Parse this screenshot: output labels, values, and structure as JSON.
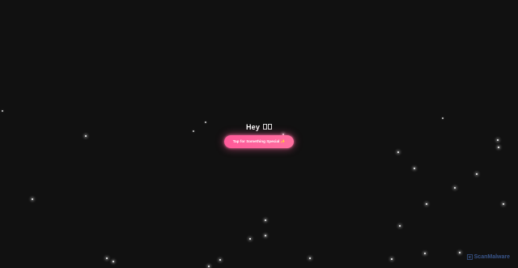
{
  "hero": {
    "greeting": "Hey",
    "cta_label": "Tap for Something Special ✨"
  },
  "watermark": {
    "text": "ScanMalware"
  },
  "colors": {
    "background": "#111111",
    "accent": "#ff5a9a",
    "watermark": "#39558a"
  }
}
